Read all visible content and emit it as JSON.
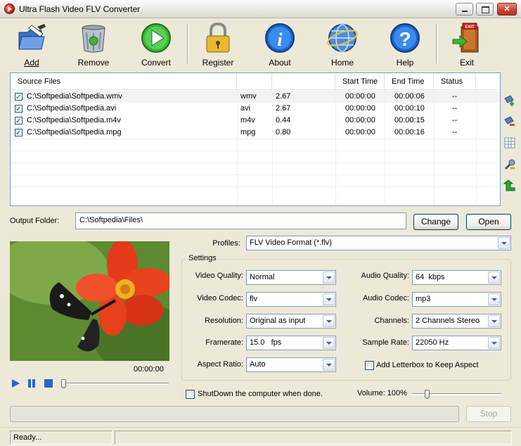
{
  "window": {
    "title": "Ultra Flash Video FLV Converter"
  },
  "toolbar": {
    "add": "Add",
    "remove": "Remove",
    "convert": "Convert",
    "register": "Register",
    "about": "About",
    "home": "Home",
    "help": "Help",
    "exit": "Exit"
  },
  "filelist": {
    "columns": [
      "Source Files",
      "",
      "",
      "Start Time",
      "End Time",
      "Status"
    ],
    "rows": [
      {
        "checked": true,
        "file": "C:\\Softpedia\\Softpedia.wmv",
        "ext": "wmv",
        "size": "2.67",
        "start": "00:00:00",
        "end": "00:00:06",
        "status": "--"
      },
      {
        "checked": true,
        "file": "C:\\Softpedia\\Softpedia.avi",
        "ext": "avi",
        "size": "2.67",
        "start": "00:00:00",
        "end": "00:00:10",
        "status": "--"
      },
      {
        "checked": true,
        "file": "C:\\Softpedia\\Softpedia.m4v",
        "ext": "m4v",
        "size": "0.44",
        "start": "00:00:00",
        "end": "00:00:15",
        "status": "--"
      },
      {
        "checked": true,
        "file": "C:\\Softpedia\\Softpedia.mpg",
        "ext": "mpg",
        "size": "0.80",
        "start": "00:00:00",
        "end": "00:00:16",
        "status": "--"
      }
    ]
  },
  "output": {
    "label": "Output Folder:",
    "value": "C:\\Softpedia\\Files\\",
    "change": "Change",
    "open": "Open"
  },
  "preview": {
    "timecode": "00:00:00"
  },
  "profiles": {
    "label": "Profiles:",
    "value": "FLV Video Format (*.flv)"
  },
  "settings": {
    "title": "Settings",
    "video_quality": {
      "label": "Video Quality:",
      "value": "Normal"
    },
    "video_codec": {
      "label": "Video Codec:",
      "value": "flv"
    },
    "resolution": {
      "label": "Resolution:",
      "value": "Original as input"
    },
    "framerate": {
      "label": "Framerate:",
      "value": "15.0   fps"
    },
    "aspect_ratio": {
      "label": "Aspect Ratio:",
      "value": "Auto"
    },
    "audio_quality": {
      "label": "Audio Quality:",
      "value": "64  kbps"
    },
    "audio_codec": {
      "label": "Audio Codec:",
      "value": "mp3"
    },
    "channels": {
      "label": "Channels:",
      "value": "2 Channels Stereo"
    },
    "sample_rate": {
      "label": "Sample Rate:",
      "value": "22050 Hz"
    },
    "letterbox": {
      "label": "Add Letterbox to Keep Aspect",
      "checked": false
    }
  },
  "shutdown": {
    "label": "ShutDown the computer when done.",
    "checked": false
  },
  "volume": {
    "label": "Volume: 100%",
    "level": 1.0
  },
  "stop_button": "Stop",
  "status": {
    "text": "Ready..."
  }
}
